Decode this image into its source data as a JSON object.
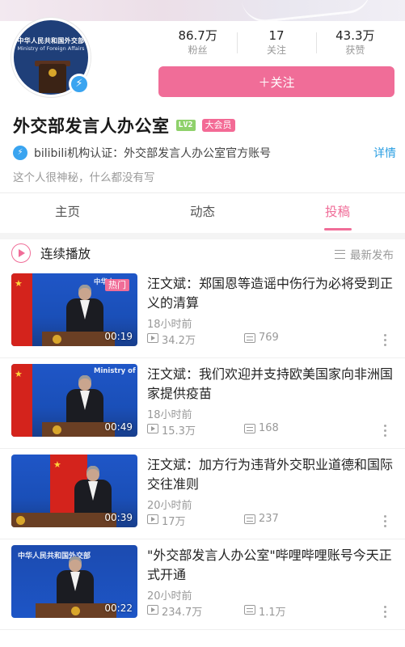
{
  "profile": {
    "avatar_text_1": "中华人民共和国外交部",
    "avatar_text_2": "Ministry of Foreign Affairs",
    "name": "外交部发言人办公室",
    "level": "LV2",
    "vip_badge": "大会员",
    "certification": "bilibili机构认证：外交部发言人办公室官方账号",
    "detail_link": "详情",
    "bio": "这个人很神秘，什么都没有写"
  },
  "stats": [
    {
      "value": "86.7万",
      "label": "粉丝"
    },
    {
      "value": "17",
      "label": "关注"
    },
    {
      "value": "43.3万",
      "label": "获赞"
    }
  ],
  "follow_button": "＋关注",
  "tabs": [
    {
      "label": "主页",
      "active": false
    },
    {
      "label": "动态",
      "active": false
    },
    {
      "label": "投稿",
      "active": true
    }
  ],
  "playlist": {
    "continuous_play": "连续播放",
    "sort_label": "最新发布"
  },
  "videos": [
    {
      "title": "汪文斌：郑国恩等造谣中伤行为必将受到正义的清算",
      "time": "18小时前",
      "views": "34.2万",
      "danmaku": "769",
      "duration": "00:19",
      "badge": "热门",
      "thumb_text": "中华人"
    },
    {
      "title": "汪文斌：我们欢迎并支持欧美国家向非洲国家提供疫苗",
      "time": "18小时前",
      "views": "15.3万",
      "danmaku": "168",
      "duration": "00:49",
      "thumb_text": "Ministry of"
    },
    {
      "title": "汪文斌：加方行为违背外交职业道德和国际交往准则",
      "time": "20小时前",
      "views": "17万",
      "danmaku": "237",
      "duration": "00:39"
    },
    {
      "title": "\"外交部发言人办公室\"哔哩哔哩账号今天正式开通",
      "time": "20小时前",
      "views": "234.7万",
      "danmaku": "1.1万",
      "duration": "00:22",
      "thumb_text": "中华人民共和国外交部"
    }
  ],
  "colors": {
    "accent": "#f06d98",
    "link": "#2a9ee2",
    "verify": "#3aa4f0"
  }
}
